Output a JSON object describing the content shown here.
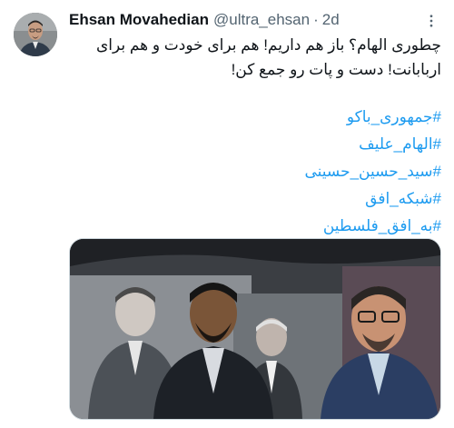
{
  "tweet": {
    "author_name": "Ehsan Movahedian",
    "handle": "@ultra_ehsan",
    "separator": "·",
    "timestamp": "2d",
    "text_line1": "چطوری الهام؟ باز هم داریم! هم برای خودت و هم برای",
    "text_line2": "اربابانت! دست و پات رو جمع کن!",
    "hashtags": [
      "#جمهوری_باکو",
      "#الهام_علیف",
      "#سید_حسین_حسینی",
      "#شبکه_افق",
      "#به_افق_فلسطین"
    ]
  },
  "icons": {
    "more": "more-vertical-icon",
    "avatar": "user-avatar"
  },
  "colors": {
    "link": "#1d9bf0",
    "secondary_text": "#536471",
    "primary_text": "#0f1419",
    "border": "#cfd9de"
  }
}
